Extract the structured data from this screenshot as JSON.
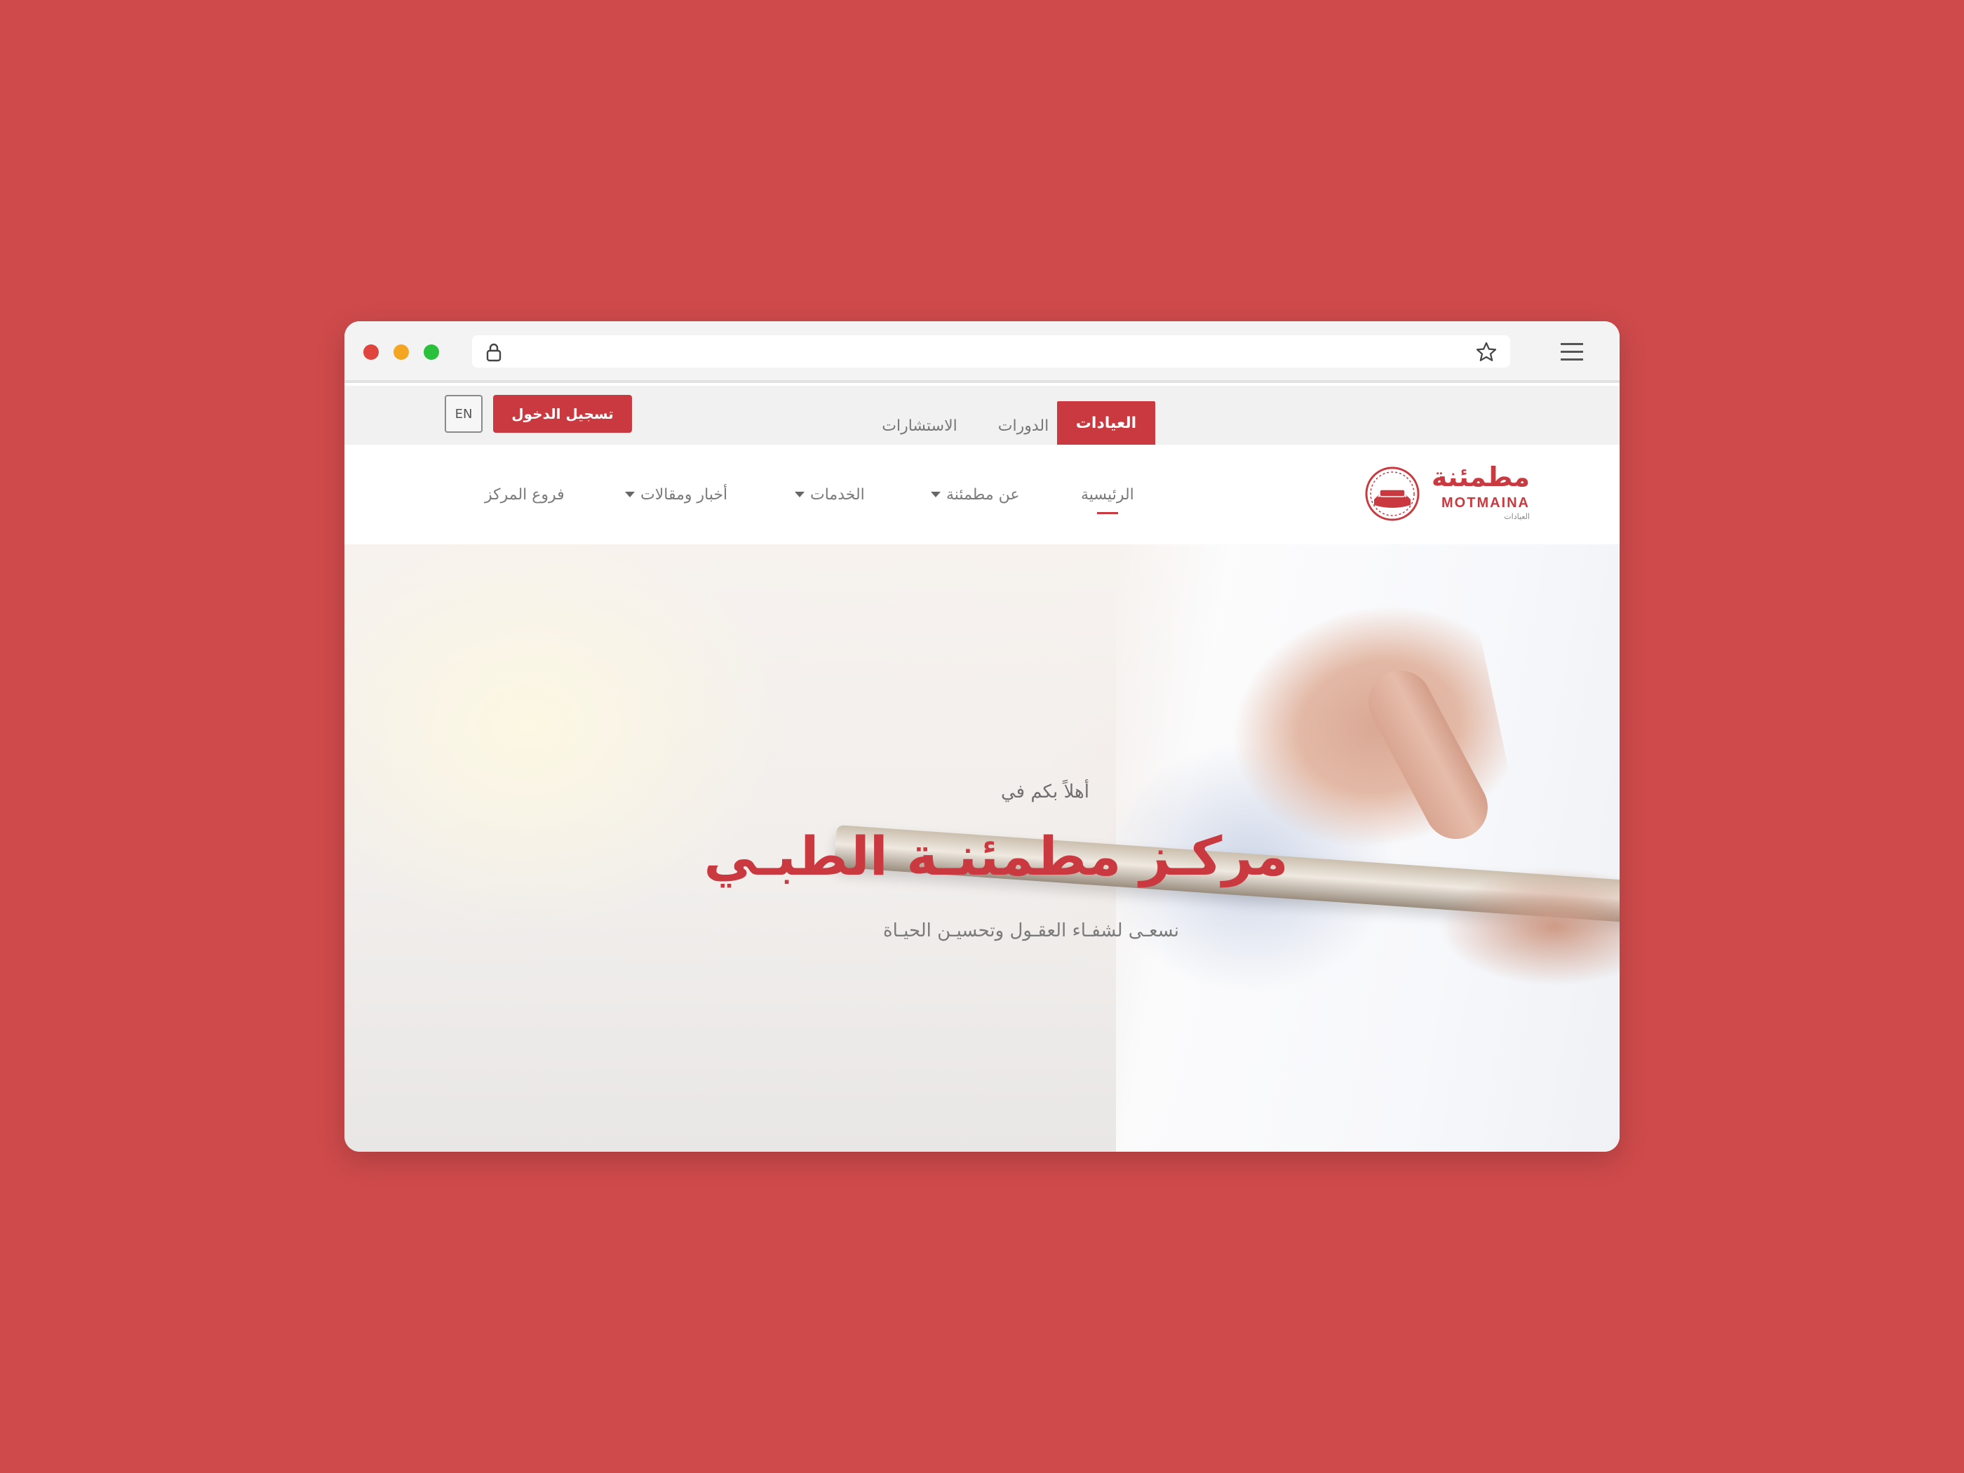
{
  "colors": {
    "background": "#cf4a4b",
    "accent": "#c9393f"
  },
  "browser": {
    "url_value": ""
  },
  "top_bar": {
    "tabs": [
      {
        "label": "العيادات",
        "active": true
      },
      {
        "label": "الدورات",
        "active": false
      },
      {
        "label": "الاستشارات",
        "active": false
      }
    ],
    "login_label": "تسجيل الدخول",
    "language_label": "EN"
  },
  "logo": {
    "arabic": "مطمئنة",
    "english": "MOTMAINA",
    "sub": "العيادات"
  },
  "nav": {
    "items": [
      {
        "label": "الرئيسية",
        "active": true,
        "dropdown": false
      },
      {
        "label": "عن مطمئنة",
        "active": false,
        "dropdown": true
      },
      {
        "label": "الخدمات",
        "active": false,
        "dropdown": true
      },
      {
        "label": "أخبار ومقالات",
        "active": false,
        "dropdown": true
      },
      {
        "label": "فروع المركز",
        "active": false,
        "dropdown": false
      }
    ]
  },
  "hero": {
    "welcome": "أهلاً بكم في",
    "title": "مركـز مطمئنـة الطبـي",
    "tagline": "نسعـى لشفـاء العقـول وتحسيـن الحيـاة"
  }
}
